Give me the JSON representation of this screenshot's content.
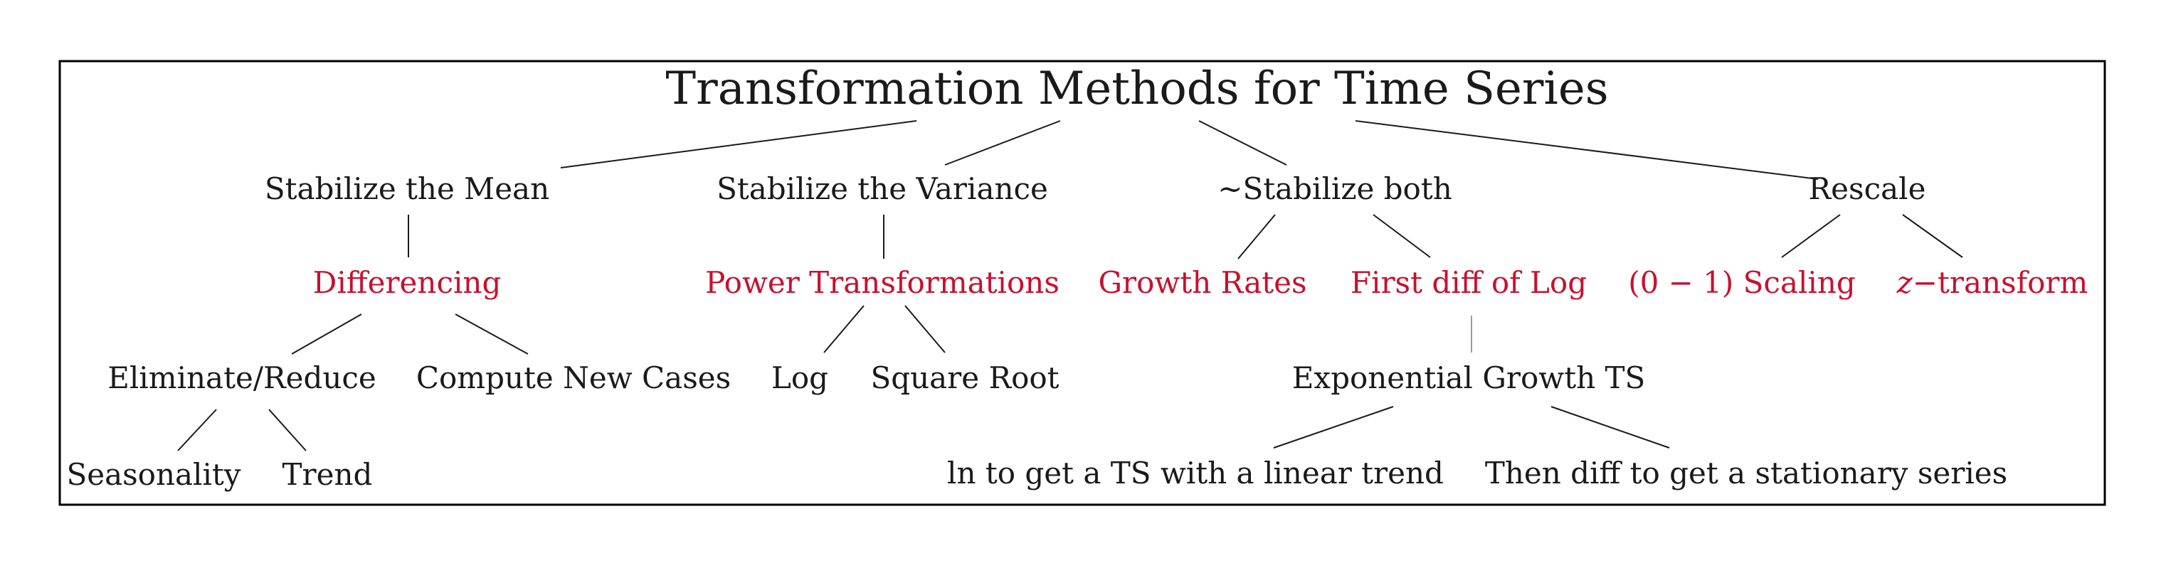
{
  "colors": {
    "text": "#1a1a1a",
    "highlight": "#c8102e",
    "edge": "#1a1a1a",
    "soft_edge": "#9a9a9a",
    "frame": "#000000"
  },
  "diagram": {
    "title": "Transformation Methods for Time Series",
    "branches": {
      "mean": {
        "label": "Stabilize the Mean",
        "method": "Differencing",
        "children": {
          "eliminate": "Eliminate/Reduce",
          "new_cases": "Compute New Cases"
        },
        "grandchildren": {
          "seasonality": "Seasonality",
          "trend": "Trend"
        }
      },
      "variance": {
        "label": "Stabilize the Variance",
        "method": "Power Transformations",
        "children": {
          "log": "Log",
          "sqrt": "Square Root"
        }
      },
      "both": {
        "label": "~Stabilize both",
        "methods": {
          "growth_rates": "Growth Rates",
          "first_diff_log": "First diff of Log"
        },
        "child": "Exponential Growth TS",
        "grandchildren": {
          "ln": "ln to get a TS with a linear trend",
          "diff": "Then diff to get a stationary series"
        }
      },
      "rescale": {
        "label": "Rescale",
        "methods": {
          "scaling": "(0 − 1) Scaling",
          "z_prefix": "z",
          "z_suffix": "−transform"
        }
      }
    }
  }
}
